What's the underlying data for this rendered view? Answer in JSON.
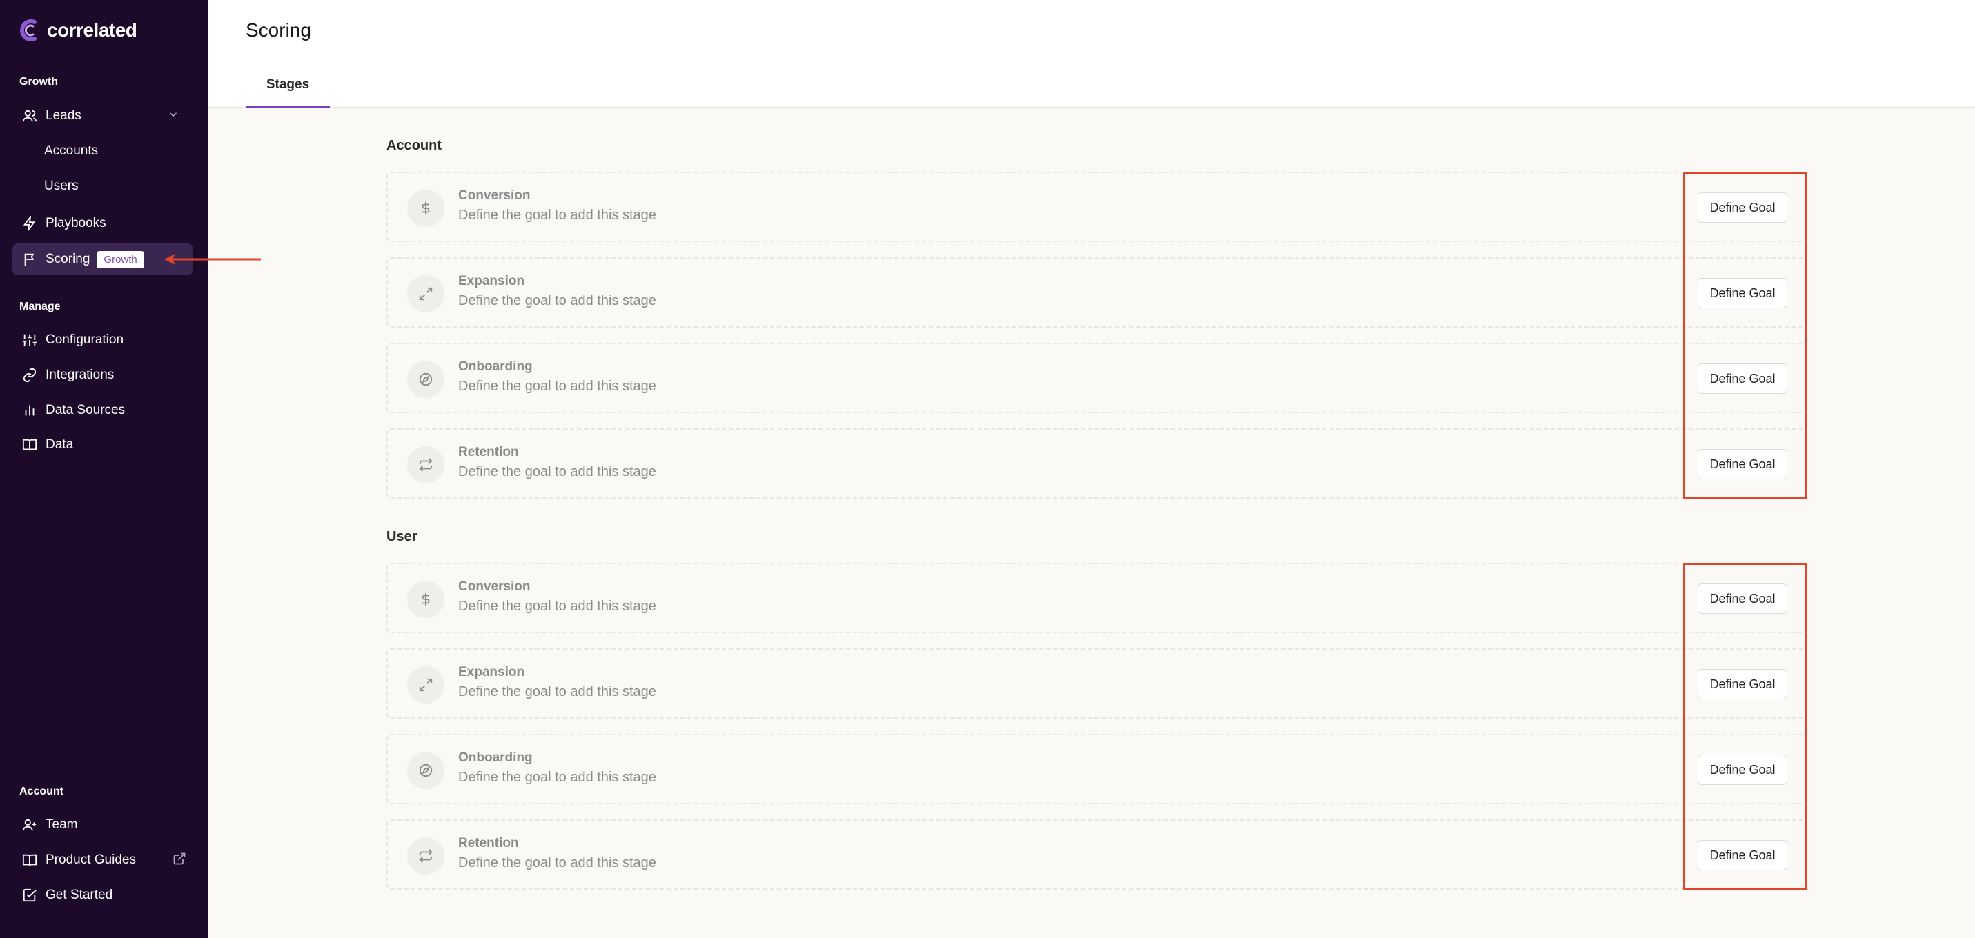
{
  "app": {
    "brand": "correlated",
    "colors": {
      "sidebar": "#1d0a2b",
      "accent": "#7b3fc4",
      "annotation": "#e3452a"
    }
  },
  "sidebar": {
    "growth_label": "Growth",
    "manage_label": "Manage",
    "account_label": "Account",
    "leads": {
      "label": "Leads",
      "icon": "users-icon",
      "children": [
        {
          "label": "Accounts"
        },
        {
          "label": "Users"
        }
      ]
    },
    "playbooks": {
      "label": "Playbooks",
      "icon": "bolt-icon"
    },
    "scoring": {
      "label": "Scoring",
      "icon": "flag-icon",
      "badge": "Growth"
    },
    "manage_items": [
      {
        "label": "Configuration",
        "icon": "sliders-icon"
      },
      {
        "label": "Integrations",
        "icon": "link-icon"
      },
      {
        "label": "Data Sources",
        "icon": "bar-chart-icon"
      },
      {
        "label": "Data",
        "icon": "book-icon"
      }
    ],
    "account_items": [
      {
        "label": "Team",
        "icon": "user-plus-icon"
      },
      {
        "label": "Product Guides",
        "icon": "book-icon"
      },
      {
        "label": "Get Started",
        "icon": "checkbox-icon"
      }
    ]
  },
  "header": {
    "title": "Scoring",
    "tabs": [
      {
        "label": "Stages"
      }
    ]
  },
  "groups": [
    {
      "title": "Account",
      "stages": [
        {
          "name": "Conversion",
          "desc": "Define the goal to add this stage",
          "icon": "dollar-icon",
          "button": "Define Goal"
        },
        {
          "name": "Expansion",
          "desc": "Define the goal to add this stage",
          "icon": "expand-icon",
          "button": "Define Goal"
        },
        {
          "name": "Onboarding",
          "desc": "Define the goal to add this stage",
          "icon": "compass-icon",
          "button": "Define Goal"
        },
        {
          "name": "Retention",
          "desc": "Define the goal to add this stage",
          "icon": "repeat-icon",
          "button": "Define Goal"
        }
      ]
    },
    {
      "title": "User",
      "stages": [
        {
          "name": "Conversion",
          "desc": "Define the goal to add this stage",
          "icon": "dollar-icon",
          "button": "Define Goal"
        },
        {
          "name": "Expansion",
          "desc": "Define the goal to add this stage",
          "icon": "expand-icon",
          "button": "Define Goal"
        },
        {
          "name": "Onboarding",
          "desc": "Define the goal to add this stage",
          "icon": "compass-icon",
          "button": "Define Goal"
        },
        {
          "name": "Retention",
          "desc": "Define the goal to add this stage",
          "icon": "repeat-icon",
          "button": "Define Goal"
        }
      ]
    }
  ]
}
